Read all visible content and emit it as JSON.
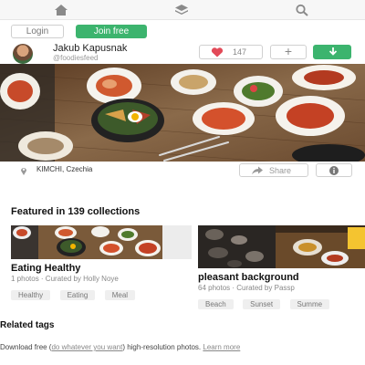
{
  "nav": {
    "icons": [
      "home-icon",
      "collections-icon",
      "search-icon"
    ]
  },
  "auth": {
    "login_label": "Login",
    "join_label": "Join free"
  },
  "user": {
    "name": "Jakub Kapusnak",
    "handle": "@foodiesfeed"
  },
  "actions": {
    "like_count": "147",
    "add_label": "+"
  },
  "photo": {
    "location": "KIMCHI, Czechia"
  },
  "meta": {
    "share_label": "Share"
  },
  "featured": {
    "title": "Featured in 139 collections",
    "collections": [
      {
        "title": "Eating Healthy",
        "subtitle": "1 photos · Curated by Holly Noye",
        "tags": [
          "Healthy",
          "Eating",
          "Meal"
        ]
      },
      {
        "title": "pleasant background",
        "subtitle": "64 photos · Curated by Passp",
        "tags": [
          "Beach",
          "Sunset",
          "Summe"
        ]
      }
    ]
  },
  "related": {
    "title": "Related tags"
  },
  "footer": {
    "prefix": "Download free (",
    "link1": "do whatever you want",
    "middle": ") high-resolution photos. ",
    "link2": "Learn more"
  },
  "colors": {
    "brand_green": "#3cb46e",
    "like_red": "#e24a58"
  }
}
